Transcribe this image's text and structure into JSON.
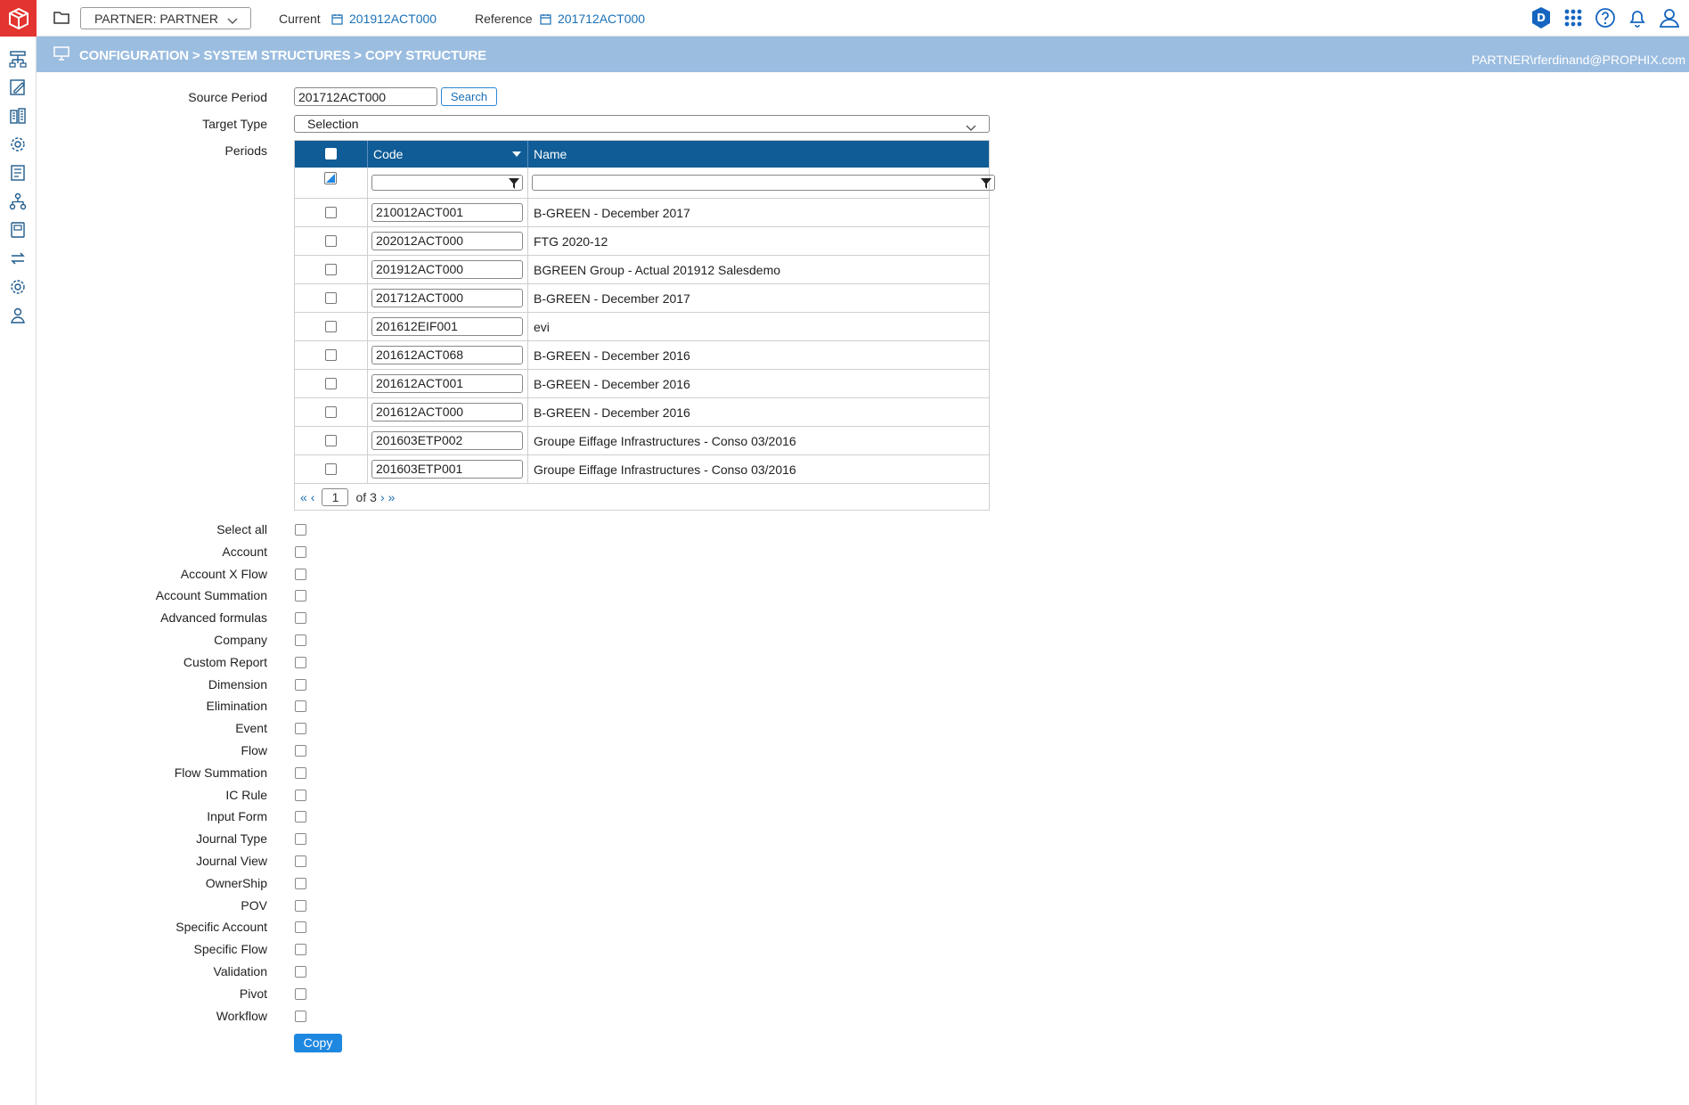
{
  "topbar": {
    "partner_select": "PARTNER: PARTNER",
    "current_label": "Current",
    "current_value": "201912ACT000",
    "reference_label": "Reference",
    "reference_value": "201712ACT000",
    "user_initial": "D"
  },
  "header": {
    "breadcrumb": "CONFIGURATION > SYSTEM STRUCTURES > COPY STRUCTURE",
    "user": "PARTNER\\rferdinand@PROPHIX.com"
  },
  "form": {
    "source_period_label": "Source Period",
    "source_period_value": "201712ACT000",
    "search_label": "Search",
    "target_type_label": "Target Type",
    "target_type_value": "Selection",
    "periods_label": "Periods"
  },
  "grid": {
    "col_code": "Code",
    "col_name": "Name",
    "rows": [
      {
        "code": "210012ACT001",
        "name": "B-GREEN - December 2017"
      },
      {
        "code": "202012ACT000",
        "name": "FTG 2020-12"
      },
      {
        "code": "201912ACT000",
        "name": "BGREEN Group - Actual 201912 Salesdemo"
      },
      {
        "code": "201712ACT000",
        "name": "B-GREEN - December 2017"
      },
      {
        "code": "201612EIF001",
        "name": "evi"
      },
      {
        "code": "201612ACT068",
        "name": "B-GREEN - December 2016"
      },
      {
        "code": "201612ACT001",
        "name": "B-GREEN - December 2016"
      },
      {
        "code": "201612ACT000",
        "name": "B-GREEN - December 2016"
      },
      {
        "code": "201603ETP002",
        "name": "Groupe Eiffage Infrastructures - Conso 03/2016"
      },
      {
        "code": "201603ETP001",
        "name": "Groupe Eiffage Infrastructures - Conso 03/2016"
      }
    ],
    "pager": {
      "first": "«",
      "prev": "‹",
      "page": "1",
      "of": "of",
      "total": "3",
      "next": "›",
      "last": "»"
    }
  },
  "options": [
    "Select all",
    "Account",
    "Account X Flow",
    "Account Summation",
    "Advanced formulas",
    "Company",
    "Custom Report",
    "Dimension",
    "Elimination",
    "Event",
    "Flow",
    "Flow Summation",
    "IC Rule",
    "Input Form",
    "Journal Type",
    "Journal View",
    "OwnerShip",
    "POV",
    "Specific Account",
    "Specific Flow",
    "Validation",
    "Pivot",
    "Workflow"
  ],
  "copy_label": "Copy",
  "colors": {
    "brand": "#e3342f",
    "band": "#9bbde0",
    "table_header": "#0f5c96",
    "link": "#1a6fb5",
    "primary_button": "#1e87e0"
  }
}
